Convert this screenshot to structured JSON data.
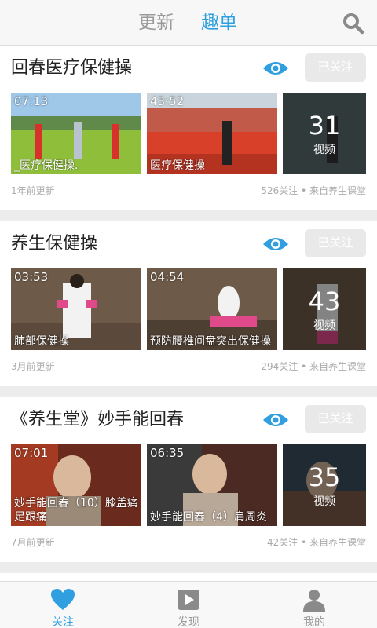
{
  "header": {
    "tab_updates": "更新",
    "tab_lists": "趣单",
    "search_icon": "search-icon"
  },
  "colors": {
    "accent": "#2f9fe0",
    "muted": "#9a9a9a",
    "follow_bg": "#e9e9e9"
  },
  "cards": [
    {
      "title": "回春医疗保健操",
      "follow_label": "已关注",
      "videos": [
        {
          "duration": "07:13",
          "caption": "_医疗保健操."
        },
        {
          "duration": "43:52",
          "caption": "医疗保健操"
        }
      ],
      "count": "31",
      "count_label": "视频",
      "updated": "1年前更新",
      "stats": "526关注 • 来自养生课堂"
    },
    {
      "title": "养生保健操",
      "follow_label": "已关注",
      "videos": [
        {
          "duration": "03:53",
          "caption": "肺部保健操"
        },
        {
          "duration": "04:54",
          "caption": "预防腰椎间盘突出保健操"
        }
      ],
      "count": "43",
      "count_label": "视频",
      "updated": "3月前更新",
      "stats": "294关注 • 来自养生课堂"
    },
    {
      "title": "《养生堂》妙手能回春",
      "follow_label": "已关注",
      "videos": [
        {
          "duration": "07:01",
          "caption": "妙手能回春（10）膝盖痛足跟痛"
        },
        {
          "duration": "06:35",
          "caption": "妙手能回春（4）肩周炎"
        }
      ],
      "count": "35",
      "count_label": "视频",
      "updated": "7月前更新",
      "stats": "42关注 • 来自养生课堂"
    }
  ],
  "bottom_nav": [
    {
      "label": "关注",
      "icon": "heart-icon",
      "active": true
    },
    {
      "label": "发现",
      "icon": "play-icon",
      "active": false
    },
    {
      "label": "我的",
      "icon": "user-icon",
      "active": false
    }
  ]
}
